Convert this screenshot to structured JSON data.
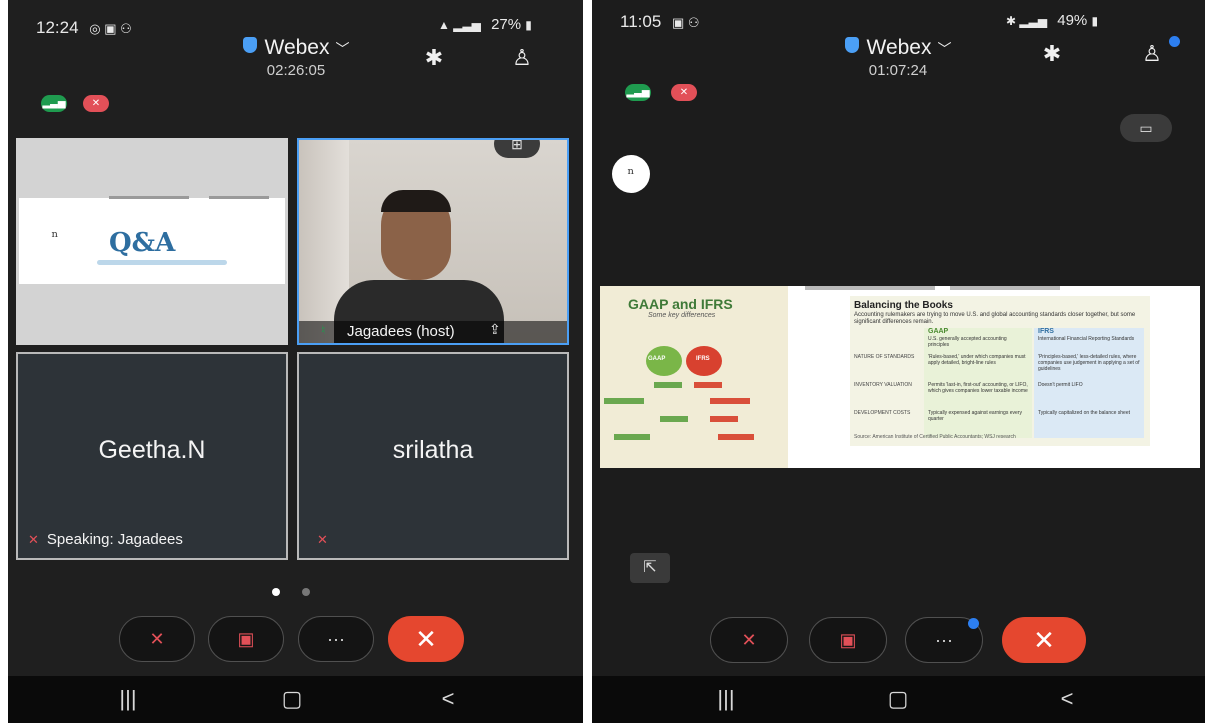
{
  "left": {
    "status_time": "12:24",
    "status_right": "27%",
    "app_name": "Webex",
    "call_timer": "02:26:05",
    "shared_content_title": "Q&A",
    "host_label": "Jagadees (host)",
    "tile_names": [
      "Geetha.N",
      "srilatha"
    ],
    "speaking_label": "Speaking: Jagadees",
    "more_label": "···",
    "end_label": "✕"
  },
  "right": {
    "status_time": "11:05",
    "status_right": "49%",
    "app_name": "Webex",
    "call_timer": "01:07:24",
    "more_label": "···",
    "end_label": "✕",
    "slide": {
      "left_title": "GAAP and IFRS",
      "left_subtitle": "Some key differences",
      "title": "Balancing the Books",
      "subtitle": "Accounting rulemakers are trying to move U.S. and global accounting standards closer together, but some significant differences remain.",
      "col_gaap": "GAAP",
      "col_gaap_sub": "U.S. generally accepted accounting principles",
      "col_ifrs": "IFRS",
      "col_ifrs_sub": "International Financial Reporting Standards",
      "rows": [
        {
          "label": "NATURE OF STANDARDS",
          "gaap": "'Rules-based,' under which companies must apply detailed, bright-line rules",
          "ifrs": "'Principles-based,' less-detailed rules, where companies use judgement in applying a set of guidelines"
        },
        {
          "label": "INVENTORY VALUATION",
          "gaap": "Permits 'last-in, first-out' accounting, or LIFO, which gives companies lower taxable income",
          "ifrs": "Doesn't permit LIFO"
        },
        {
          "label": "DEVELOPMENT COSTS",
          "gaap": "Typically expensed against earnings every quarter",
          "ifrs": "Typically capitalized on the balance sheet"
        }
      ],
      "source": "Source: American Institute of Certified Public Accountants; WSJ research"
    }
  },
  "colors": {
    "accent_blue": "#4b9ff5",
    "end_red": "#e5472f",
    "mute_red": "#e25058",
    "signal_green": "#1f9b4f"
  }
}
